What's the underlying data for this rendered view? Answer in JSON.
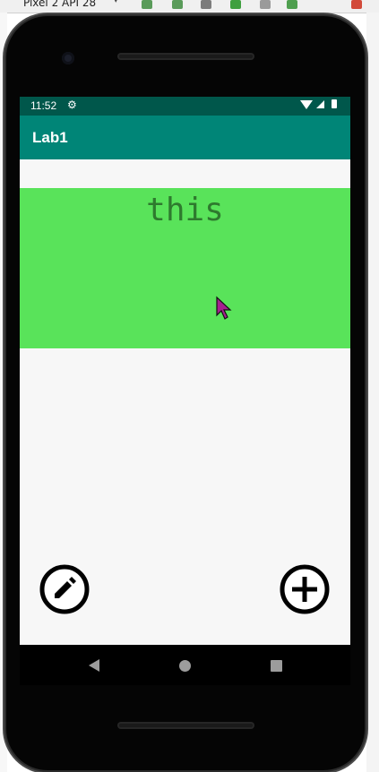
{
  "ide": {
    "device_label": "Pixel 2 API 28",
    "dropdown_glyph": "▾"
  },
  "status_bar": {
    "time": "11:52",
    "icons": [
      "gear-icon",
      "wifi-icon",
      "signal-icon",
      "battery-icon"
    ]
  },
  "app_bar": {
    "title": "Lab1"
  },
  "content": {
    "text": "this",
    "panel_color": "#59e35a"
  },
  "fabs": {
    "edit_icon": "edit-pencil-icon",
    "add_icon": "add-circle-icon"
  },
  "nav_bar": {
    "buttons": [
      "back",
      "home",
      "recents"
    ]
  },
  "colors": {
    "status_bar": "#00574b",
    "app_bar": "#008577",
    "background": "#f7f7f7"
  }
}
